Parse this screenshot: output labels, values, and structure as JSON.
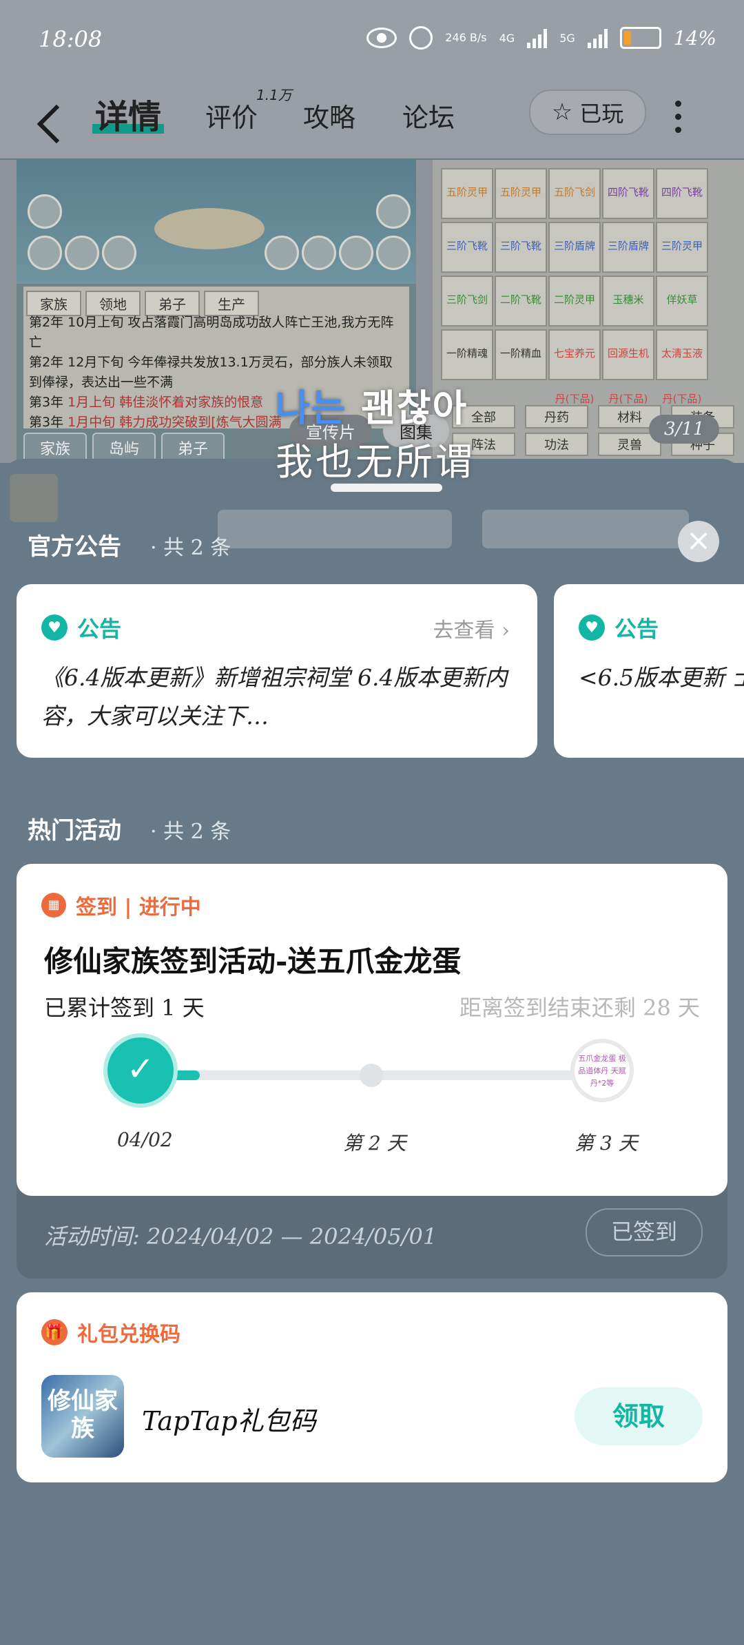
{
  "status": {
    "time": "18:08",
    "net_speed": "246 B/s",
    "net_type": "4G",
    "net_type2": "5G",
    "battery": "14%"
  },
  "nav": {
    "tabs": [
      {
        "label": "详情"
      },
      {
        "label": "评价",
        "count": "1.1万"
      },
      {
        "label": "攻略"
      },
      {
        "label": "论坛"
      }
    ],
    "played_label": "已玩"
  },
  "gallery": {
    "shot1_tabs": [
      "家族",
      "领地",
      "弟子",
      "生产"
    ],
    "log": [
      {
        "year": "第2年",
        "text": "10月上旬 攻占落霞门高明岛成功敌人阵亡王池,我方无阵亡"
      },
      {
        "year": "第2年",
        "text": "12月下旬 今年俸禄共发放13.1万灵石，部分族人未领取到俸禄，表达出一些不满"
      },
      {
        "year": "第3年",
        "text": "1月上旬 韩佳淡怀着对家族的恨意"
      },
      {
        "year": "第3年",
        "text": "1月中旬 韩力成功突破到[炼气大圆满"
      }
    ],
    "bottom_tabs": [
      "家族",
      "岛屿",
      "弟子"
    ],
    "shot2_cells": [
      "五阶灵甲",
      "五阶灵甲",
      "五阶飞剑",
      "四阶飞靴",
      "四阶飞靴",
      "三阶飞靴",
      "三阶飞靴",
      "三阶盾牌",
      "三阶盾牌",
      "三阶灵甲",
      "三阶飞剑",
      "二阶飞靴",
      "二阶灵甲",
      "玉穗米",
      "佯妖草",
      "一阶精魂",
      "一阶精血",
      "七宝养元丹(下品)",
      "回源生机丹(下品)",
      "太清玉液丹(下品)"
    ],
    "inv_tabs_row1": [
      "全部",
      "丹药",
      "材料",
      "装备"
    ],
    "inv_tabs_row2": [
      "阵法",
      "功法",
      "灵兽",
      "种子"
    ],
    "caption_promo": "宣传片",
    "caption_gallery": "图集",
    "counter": "3/11",
    "overlay_korean_blue": "나는",
    "overlay_korean_white": " 괜찮아",
    "overlay_chinese": "我也无所谓"
  },
  "notices": {
    "title": "官方公告",
    "count": "· 共 2 条",
    "items": [
      {
        "badge": "公告",
        "link": "去查看",
        "text": "《6.4版本更新》新增祖宗祠堂 6.4版本更新内容，大家可以关注下…"
      },
      {
        "badge": "公告",
        "text": "<6.5版本更新 士"
      }
    ]
  },
  "activities": {
    "title": "热门活动",
    "count": "· 共 2 条",
    "tag": "签到 | 进行中",
    "name": "修仙家族签到活动-送五爪金龙蛋",
    "progress": "已累计签到 1 天",
    "remain": "距离签到结束还剩 28 天",
    "progress_fraction": 0.13,
    "days": [
      "04/02",
      "第 2 天",
      "第 3 天"
    ],
    "reward_end": "五爪金龙蛋 极品道体丹 天赋丹*2等",
    "time": "活动时间: 2024/04/02 — 2024/05/01",
    "signed_label": "已签到"
  },
  "gift": {
    "tag": "礼包兑换码",
    "logo_text": "修仙家族",
    "name": "TapTap礼包码",
    "claim_label": "领取"
  },
  "colors": {
    "accent": "#12b6a4",
    "orange": "#ee6a3c",
    "overlay": "#687a87"
  }
}
